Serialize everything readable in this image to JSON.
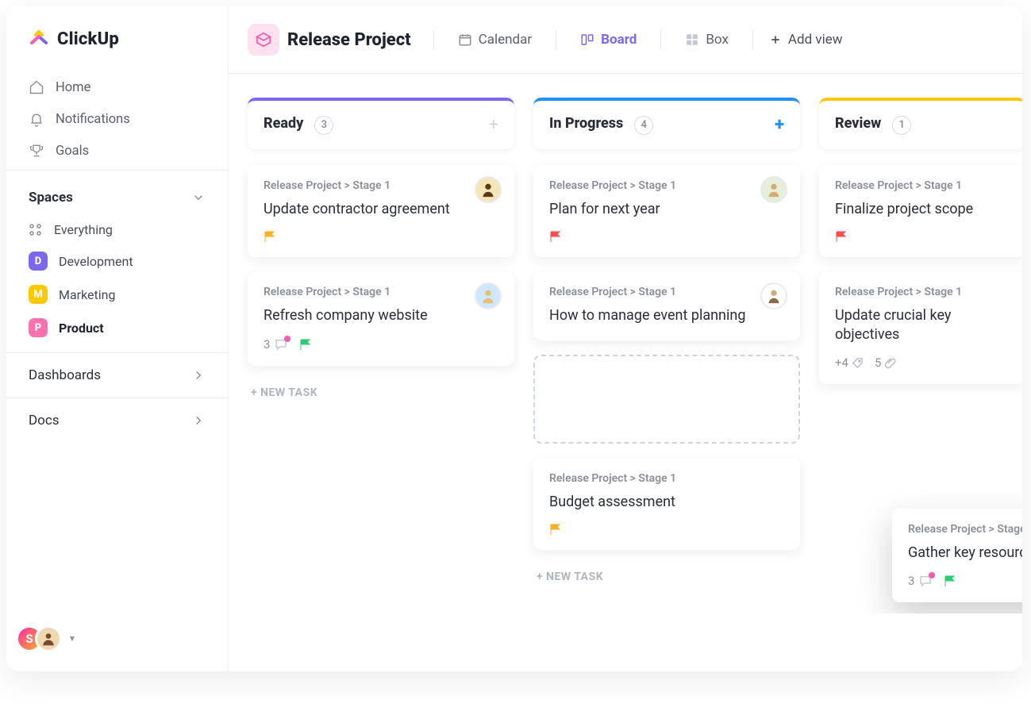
{
  "brand": "ClickUp",
  "nav": {
    "home": "Home",
    "notifications": "Notifications",
    "goals": "Goals"
  },
  "spaces": {
    "header": "Spaces",
    "everything": "Everything",
    "items": [
      {
        "initial": "D",
        "label": "Development"
      },
      {
        "initial": "M",
        "label": "Marketing"
      },
      {
        "initial": "P",
        "label": "Product"
      }
    ]
  },
  "footer": {
    "dashboards": "Dashboards",
    "docs": "Docs"
  },
  "user_initial": "S",
  "topbar": {
    "project": "Release Project",
    "views": {
      "calendar": "Calendar",
      "board": "Board",
      "box": "Box",
      "add": "Add view"
    }
  },
  "breadcrumb": "Release Project > Stage 1",
  "columns": {
    "ready": {
      "title": "Ready",
      "count": "3"
    },
    "progress": {
      "title": "In Progress",
      "count": "4"
    },
    "review": {
      "title": "Review",
      "count": "1"
    }
  },
  "cards": {
    "ready1": {
      "title": "Update contractor agreement"
    },
    "ready2": {
      "title": "Refresh company website",
      "comments": "3"
    },
    "prog1": {
      "title": "Plan for next year"
    },
    "prog2": {
      "title": "How to manage event planning"
    },
    "prog3": {
      "title": "Budget assessment"
    },
    "review1": {
      "title": "Finalize project scope"
    },
    "review2": {
      "title": "Update crucial key objectives",
      "plus": "+4",
      "attach": "5"
    },
    "drag": {
      "title": "Gather key resources",
      "comments": "3"
    }
  },
  "new_task": "+ NEW TASK"
}
